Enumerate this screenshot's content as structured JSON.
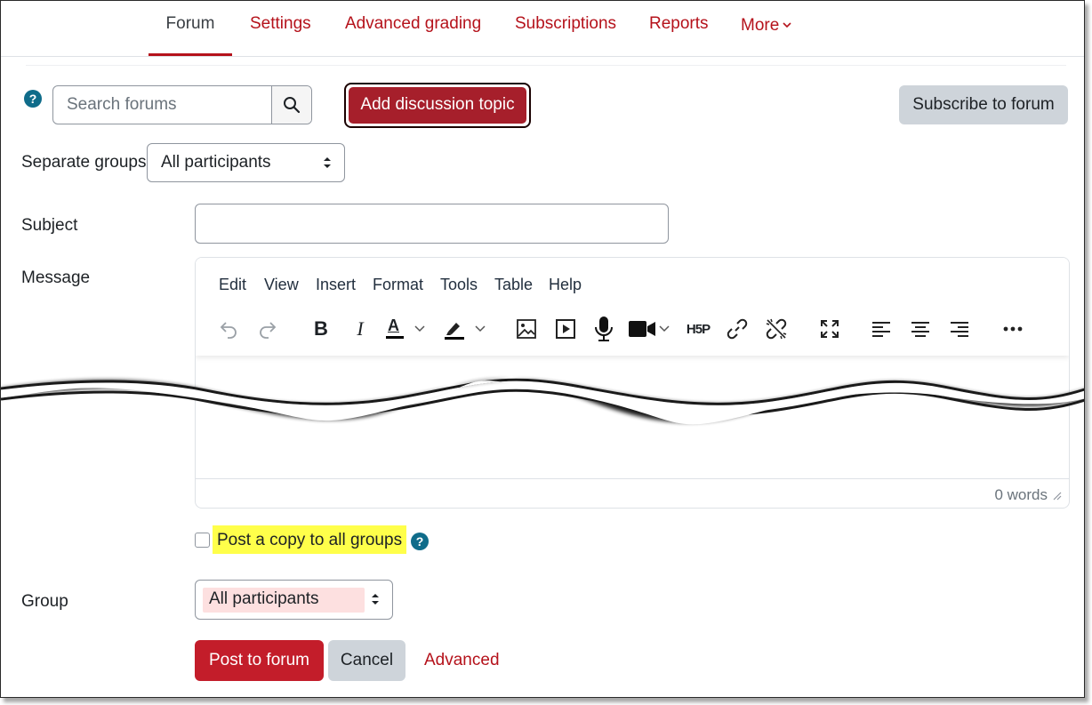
{
  "tabs": [
    {
      "label": "Forum",
      "active": true
    },
    {
      "label": "Settings",
      "active": false
    },
    {
      "label": "Advanced grading",
      "active": false
    },
    {
      "label": "Subscriptions",
      "active": false
    },
    {
      "label": "Reports",
      "active": false
    },
    {
      "label": "More",
      "active": false
    }
  ],
  "search": {
    "placeholder": "Search forums",
    "value": ""
  },
  "help_glyph": "?",
  "buttons": {
    "add_topic": "Add discussion topic",
    "subscribe": "Subscribe to forum",
    "post": "Post to forum",
    "cancel": "Cancel",
    "advanced": "Advanced"
  },
  "groups_filter": {
    "label": "Separate groups",
    "selected": "All participants"
  },
  "form": {
    "subject_label": "Subject",
    "subject_value": "",
    "message_label": "Message",
    "copy_label": "Post a copy to all groups",
    "copy_checked": false,
    "group_label": "Group",
    "group_selected": "All participants"
  },
  "editor": {
    "menu": [
      "Edit",
      "View",
      "Insert",
      "Format",
      "Tools",
      "Table",
      "Help"
    ],
    "toolbar": [
      "undo-icon",
      "redo-icon",
      "bold-icon",
      "italic-icon",
      "text-color-icon",
      "highlight-color-icon",
      "image-icon",
      "media-icon",
      "microphone-icon",
      "video-camera-icon",
      "h5p-icon",
      "link-icon",
      "unlink-icon",
      "fullscreen-icon",
      "align-left-icon",
      "align-center-icon",
      "align-right-icon",
      "more-icon"
    ],
    "bold_glyph": "B",
    "italic_glyph": "I",
    "text_color_glyph": "A",
    "h5p_glyph": "H5P",
    "word_count": "0 words"
  },
  "colors": {
    "accent": "#b5121b",
    "primary_button": "#c31d2a",
    "add_topic_button": "#a61f2b",
    "secondary_button": "#ced4da",
    "help_icon": "#0f6c8a",
    "highlight": "#ffff4a",
    "group_highlight": "#fde0e0"
  }
}
